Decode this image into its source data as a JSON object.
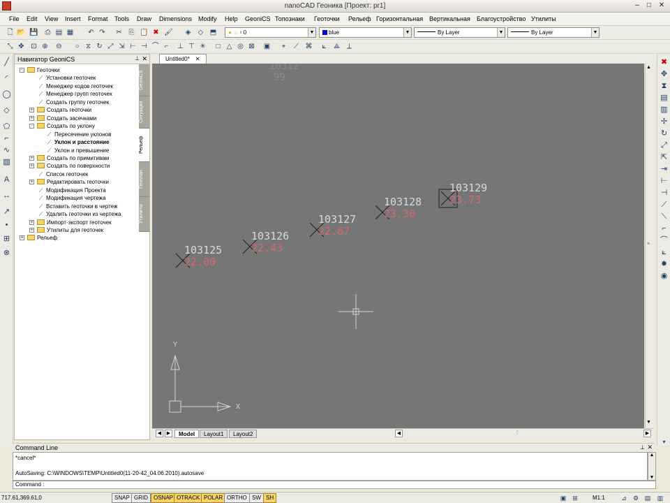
{
  "window": {
    "title": "nanoCAD Геоника [Проект: pr1]"
  },
  "menu": [
    "File",
    "Edit",
    "View",
    "Insert",
    "Format",
    "Tools",
    "Draw",
    "Dimensions",
    "Modify",
    "Help",
    "GeoniCS",
    "Топознаки",
    "Геоточки",
    "Рельеф",
    "Горизонтальная",
    "Вертикальная",
    "Благоустройство",
    "Утилиты"
  ],
  "properties": {
    "layer": "0",
    "color": "blue",
    "linetype": "By Layer",
    "lineweight": "By Layer"
  },
  "navigator": {
    "title": "Навигатор GeoniCS",
    "tree": [
      {
        "label": "Геоточки",
        "level": 0,
        "kind": "folder",
        "exp": "-"
      },
      {
        "label": "Установки геоточек",
        "level": 1,
        "kind": "item"
      },
      {
        "label": "Менеджер кодов геоточек",
        "level": 1,
        "kind": "item"
      },
      {
        "label": "Менеджер групп геоточек",
        "level": 1,
        "kind": "item"
      },
      {
        "label": "Создать группу геоточек",
        "level": 1,
        "kind": "item"
      },
      {
        "label": "Создать геоточки",
        "level": 1,
        "kind": "folder",
        "exp": "+"
      },
      {
        "label": "Создать засечками",
        "level": 1,
        "kind": "folder",
        "exp": "+"
      },
      {
        "label": "Создать по уклону",
        "level": 1,
        "kind": "folder",
        "exp": "-"
      },
      {
        "label": "Пересечение уклонов",
        "level": 2,
        "kind": "item"
      },
      {
        "label": "Уклон и расстояние",
        "level": 2,
        "kind": "item",
        "bold": true
      },
      {
        "label": "Уклон и превышение",
        "level": 2,
        "kind": "item"
      },
      {
        "label": "Создать по примитивам",
        "level": 1,
        "kind": "folder",
        "exp": "+"
      },
      {
        "label": "Создать по поверхности",
        "level": 1,
        "kind": "folder",
        "exp": "+"
      },
      {
        "label": "Список геоточек",
        "level": 1,
        "kind": "item"
      },
      {
        "label": "Редактировать геоточки",
        "level": 1,
        "kind": "folder",
        "exp": "+"
      },
      {
        "label": "Модификация Проекта",
        "level": 1,
        "kind": "item"
      },
      {
        "label": "Модификация чертежа",
        "level": 1,
        "kind": "item"
      },
      {
        "label": "Вставить геоточки в чертеж",
        "level": 1,
        "kind": "item"
      },
      {
        "label": "Удалить геоточки из чертежа",
        "level": 1,
        "kind": "item"
      },
      {
        "label": "Импорт-экспорт геоточек",
        "level": 1,
        "kind": "folder",
        "exp": "+"
      },
      {
        "label": "Утилиты для геоточек",
        "level": 1,
        "kind": "folder",
        "exp": "+"
      },
      {
        "label": "Рельеф",
        "level": 0,
        "kind": "folder",
        "exp": "+"
      }
    ],
    "side_tabs": [
      "GeoniCS",
      "Ситуация",
      "Рельеф",
      "Генплан",
      "Утилиты"
    ]
  },
  "document": {
    "tab": "Untitled0*"
  },
  "drawing": {
    "points": [
      {
        "number": "103125",
        "elevation": "22.00"
      },
      {
        "number": "103126",
        "elevation": "22.43"
      },
      {
        "number": "103127",
        "elevation": "22.87"
      },
      {
        "number": "103128",
        "elevation": "23.30"
      },
      {
        "number": "103129",
        "elevation": "23.73"
      }
    ],
    "ucs": {
      "x": "X",
      "y": "Y"
    }
  },
  "layout_tabs": [
    "Model",
    "Layout1",
    "Layout2"
  ],
  "command": {
    "title": "Command Line",
    "history": [
      "*cancel*",
      "",
      "AutoSaving: C:\\WINDOWS\\TEMP\\Untitled0(11-20-42_04.06.2010).autosave"
    ],
    "prompt": "Command :"
  },
  "status": {
    "coords": "717.61,369.61,0",
    "toggles": [
      {
        "label": "SNAP",
        "on": false
      },
      {
        "label": "GRID",
        "on": false
      },
      {
        "label": "OSNAP",
        "on": true
      },
      {
        "label": "OTRACK",
        "on": true
      },
      {
        "label": "POLAR",
        "on": true
      },
      {
        "label": "ORTHO",
        "on": false
      },
      {
        "label": "SW",
        "on": false
      },
      {
        "label": "SH",
        "on": true
      }
    ],
    "scale": "M1:1"
  },
  "colors": {
    "canvas": "#767676",
    "elevation": "#d26a6a",
    "label": "#d8d8d8",
    "toggle_on": "#f7d26a"
  }
}
